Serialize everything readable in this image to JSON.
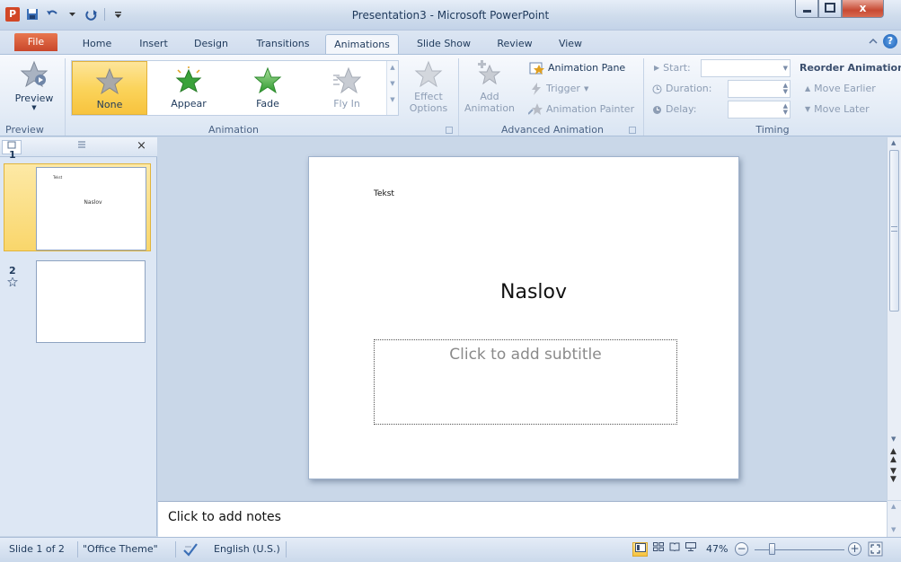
{
  "app": {
    "logo_letter": "P",
    "window_title": "Presentation3 - Microsoft PowerPoint",
    "close_glyph": "x"
  },
  "tabs": [
    {
      "label": "File"
    },
    {
      "label": "Home"
    },
    {
      "label": "Insert"
    },
    {
      "label": "Design"
    },
    {
      "label": "Transitions"
    },
    {
      "label": "Animations"
    },
    {
      "label": "Slide Show"
    },
    {
      "label": "Review"
    },
    {
      "label": "View"
    }
  ],
  "active_tab": "Animations",
  "help": {
    "glyph": "?"
  },
  "ribbon": {
    "preview": {
      "label": "Preview",
      "group_label": "Preview"
    },
    "animation": {
      "group_label": "Animation",
      "items": [
        {
          "label": "None",
          "selected": true
        },
        {
          "label": "Appear"
        },
        {
          "label": "Fade"
        },
        {
          "label": "Fly In"
        }
      ],
      "effect_options": {
        "line1": "Effect",
        "line2": "Options"
      }
    },
    "advanced": {
      "group_label": "Advanced Animation",
      "add_animation": {
        "line1": "Add",
        "line2": "Animation"
      },
      "animation_pane": "Animation Pane",
      "trigger": "Trigger",
      "animation_painter": "Animation Painter"
    },
    "timing": {
      "group_label": "Timing",
      "start": "Start:",
      "duration": "Duration:",
      "delay": "Delay:",
      "reorder": "Reorder Animation",
      "move_earlier": "Move Earlier",
      "move_later": "Move Later"
    }
  },
  "slides_pane": {
    "close_glyph": "×",
    "slides": [
      {
        "number": "1",
        "thumb_small": "Tekst",
        "thumb_title": "Naslov"
      },
      {
        "number": "2"
      }
    ]
  },
  "slide": {
    "tekst": "Tekst",
    "title": "Naslov",
    "subtitle_placeholder": "Click to add subtitle"
  },
  "notes": {
    "placeholder": "Click to add notes"
  },
  "status": {
    "slide_info": "Slide 1 of 2",
    "theme": "\"Office Theme\"",
    "language": "English (U.S.)",
    "zoom": "47%"
  },
  "colors": {
    "accent_file_tab": "#d24726",
    "selected_gallery": "#fbd45c",
    "star_green": "#3aa23a",
    "window_bg": "#c9d7e8"
  }
}
